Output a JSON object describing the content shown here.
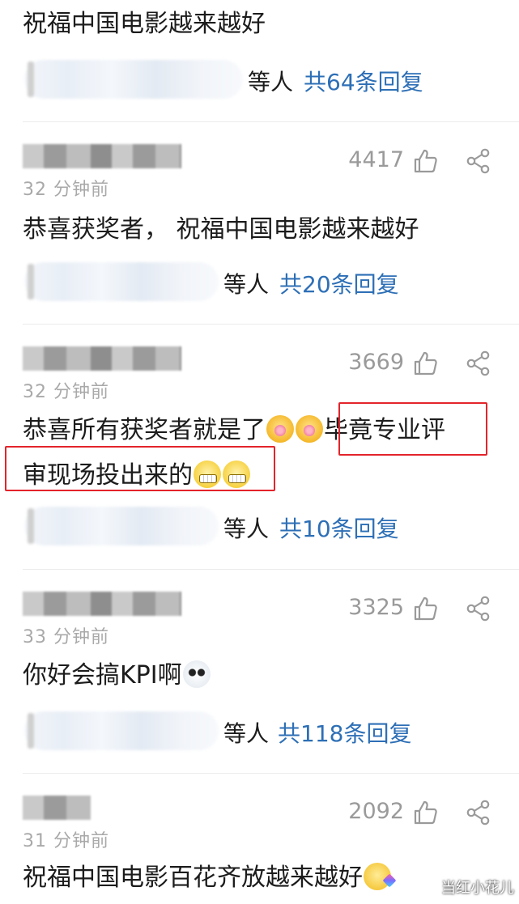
{
  "comments": [
    {
      "text": "祝福中国电影越来越好",
      "reply_suffix": "等人",
      "reply_total": "共64条回复"
    },
    {
      "time": "32 分钟前",
      "likes": "4417",
      "text": "恭喜获奖者， 祝福中国电影越来越好",
      "reply_suffix": "等人",
      "reply_total": "共20条回复"
    },
    {
      "time": "32 分钟前",
      "likes": "3669",
      "text_part1": "恭喜所有获奖者就是了",
      "text_part2": "毕竟专业评",
      "text_part3": "审现场投出来的",
      "emojis": [
        "flower-emoji",
        "flower-emoji",
        "grin-emoji",
        "grin-emoji"
      ],
      "reply_suffix": "等人",
      "reply_total": "共10条回复"
    },
    {
      "time": "33 分钟前",
      "likes": "3325",
      "text": "你好会搞KPI啊",
      "emojis": [
        "panda-emoji"
      ],
      "reply_suffix": "等人",
      "reply_total": "共118条回复"
    },
    {
      "time": "31 分钟前",
      "likes": "2092",
      "text": "祝福中国电影百花齐放越来越好",
      "emojis": [
        "kiss-emoji"
      ]
    }
  ],
  "icons": {
    "like": "thumbs-up-icon",
    "share": "share-icon"
  },
  "colors": {
    "reply_link": "#2d6fb6",
    "highlight": "#e3242b",
    "meta_gray": "#9a9a9a"
  },
  "watermark": "当红小花儿"
}
